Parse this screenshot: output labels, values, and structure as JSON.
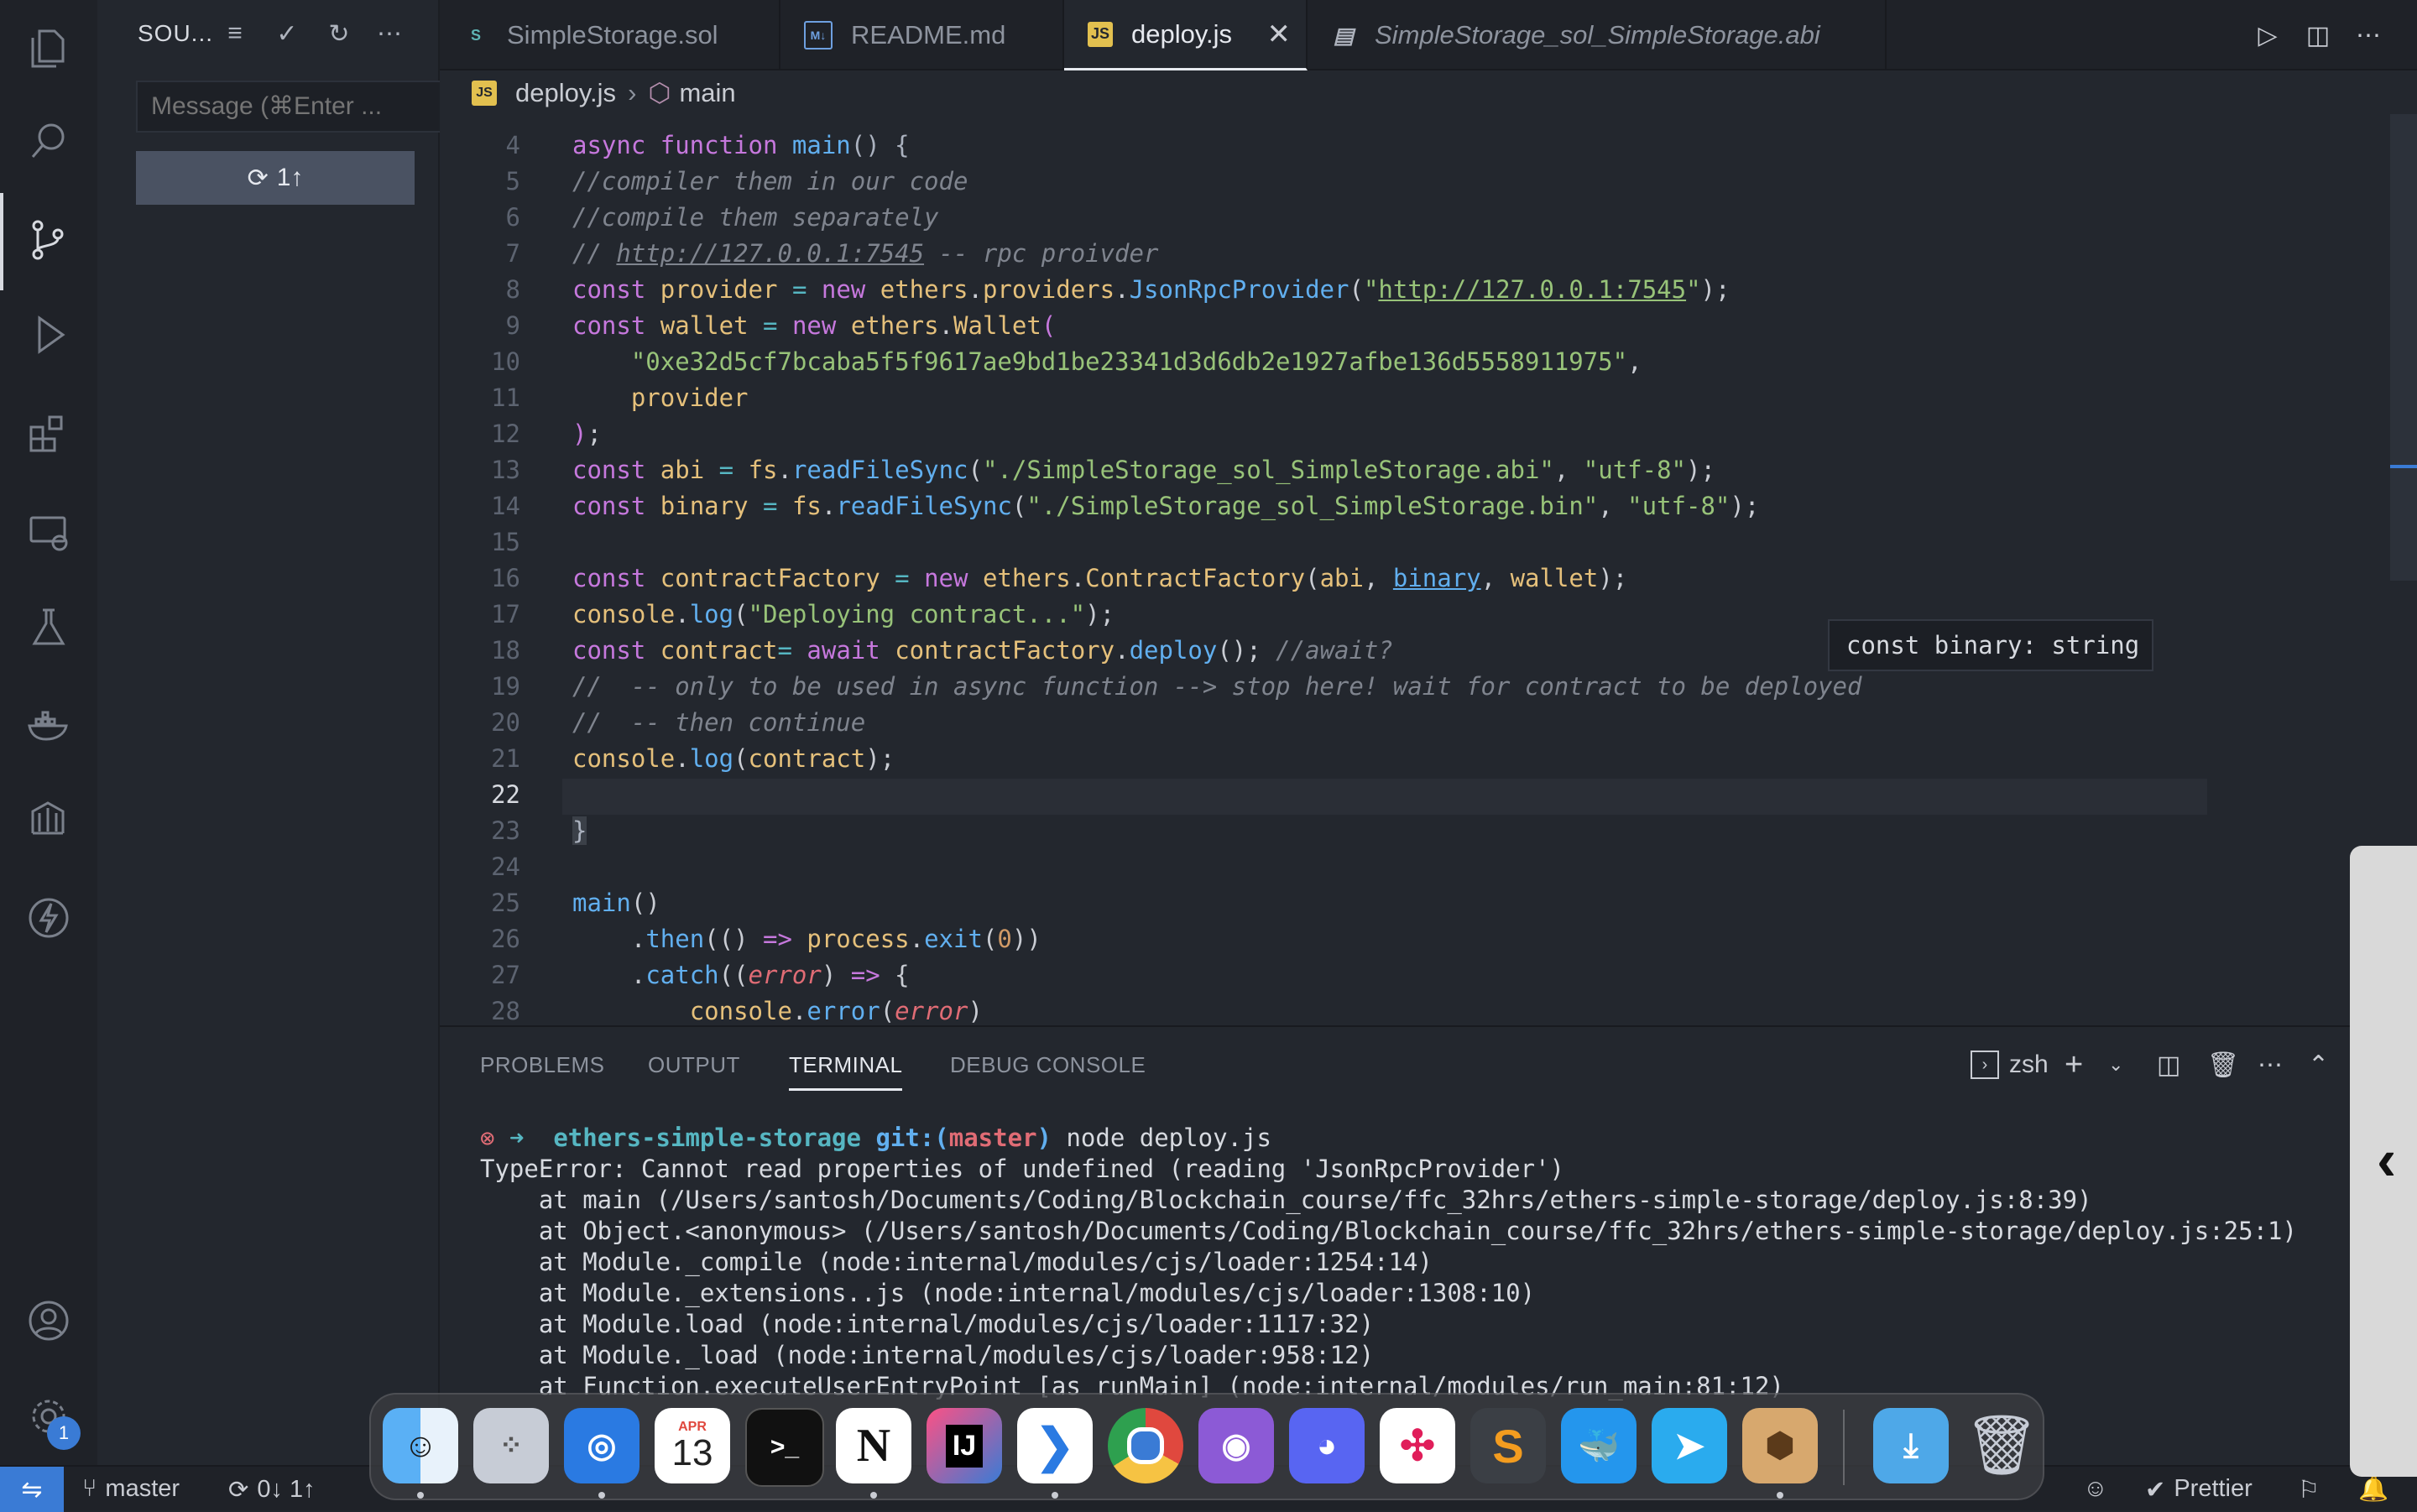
{
  "sidebar": {
    "title": "SOU...",
    "message_placeholder": "Message (⌘Enter ...",
    "sync_label": "1↑"
  },
  "tabs": [
    {
      "label": "SimpleStorage.sol",
      "icon": "solidity-icon"
    },
    {
      "label": "README.md",
      "icon": "markdown-icon"
    },
    {
      "label": "deploy.js",
      "icon": "js-icon",
      "active": true
    },
    {
      "label": "SimpleStorage_sol_SimpleStorage.abi",
      "icon": "file-icon"
    }
  ],
  "breadcrumb": {
    "file": "deploy.js",
    "symbol": "main"
  },
  "editor": {
    "tooltip": "const binary: string",
    "line_numbers": [
      "4",
      "5",
      "6",
      "7",
      "8",
      "9",
      "10",
      "11",
      "12",
      "13",
      "14",
      "15",
      "16",
      "17",
      "18",
      "19",
      "20",
      "21",
      "22",
      "23",
      "24",
      "25",
      "26",
      "27",
      "28"
    ],
    "current_line": "22"
  },
  "panel": {
    "tabs": [
      "PROBLEMS",
      "OUTPUT",
      "TERMINAL",
      "DEBUG CONSOLE"
    ],
    "active_tab": "TERMINAL",
    "shell": "zsh",
    "prompt_dir": "ethers-simple-storage",
    "prompt_git": "git:(",
    "prompt_branch": "master",
    "prompt_git_close": ")",
    "command": "node deploy.js",
    "output": [
      "TypeError: Cannot read properties of undefined (reading 'JsonRpcProvider')",
      "    at main (/Users/santosh/Documents/Coding/Blockchain_course/ffc_32hrs/ethers-simple-storage/deploy.js:8:39)",
      "    at Object.<anonymous> (/Users/santosh/Documents/Coding/Blockchain_course/ffc_32hrs/ethers-simple-storage/deploy.js:25:1)",
      "    at Module._compile (node:internal/modules/cjs/loader:1254:14)",
      "    at Module._extensions..js (node:internal/modules/cjs/loader:1308:10)",
      "    at Module.load (node:internal/modules/cjs/loader:1117:32)",
      "    at Module._load (node:internal/modules/cjs/loader:958:12)",
      "    at Function.executeUserEntryPoint [as runMain] (node:internal/modules/run_main:81:12)"
    ]
  },
  "status": {
    "branch": "master",
    "sync": "0↓ 1↑",
    "prettier": "Prettier",
    "settings_badge": "1"
  },
  "dock": {
    "calendar_month": "APR",
    "calendar_day": "13",
    "intellij": "IJ",
    "notion": "N"
  },
  "colors": {
    "accent": "#3a7bd5",
    "editor_bg": "#23272e",
    "error": "#e06c75"
  }
}
